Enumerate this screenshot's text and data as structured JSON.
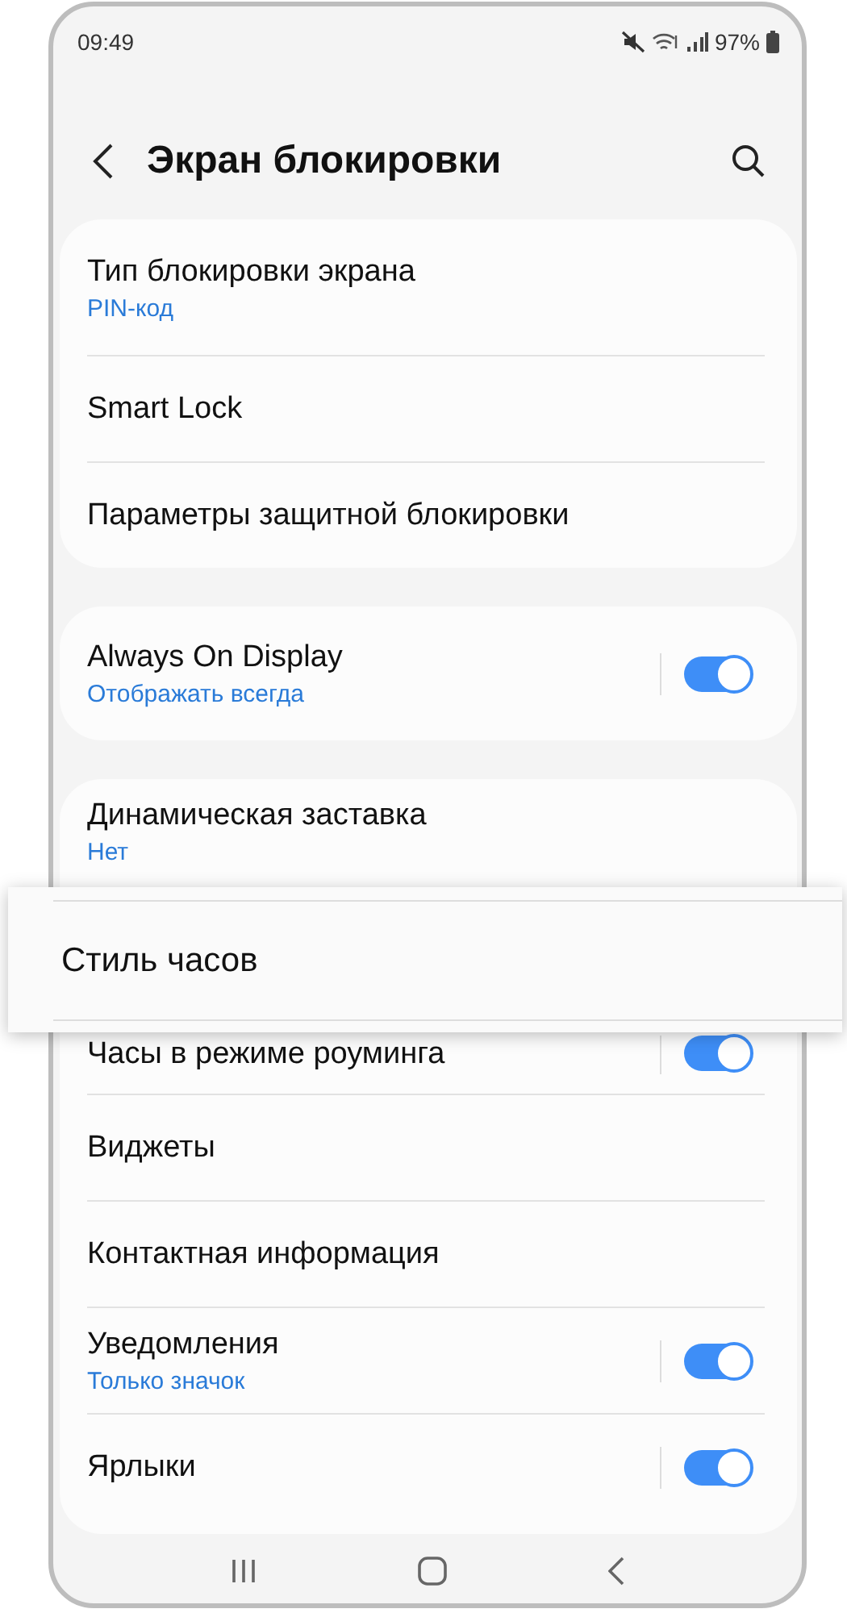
{
  "status_bar": {
    "time": "09:49",
    "battery": "97%"
  },
  "header": {
    "title": "Экран блокировки"
  },
  "groups": [
    {
      "items": [
        {
          "kind": "text",
          "title": "Тип блокировки экрана",
          "subtitle": "PIN-код"
        },
        {
          "kind": "text",
          "title": "Smart Lock"
        },
        {
          "kind": "text",
          "title": "Параметры защитной блокировки"
        }
      ]
    },
    {
      "items": [
        {
          "kind": "toggle",
          "title": "Always On Display",
          "subtitle": "Отображать всегда",
          "on": true
        }
      ]
    },
    {
      "items": [
        {
          "kind": "text",
          "title": "Динамическая заставка",
          "subtitle": "Нет"
        },
        {
          "kind": "highlight",
          "title": "Стиль часов"
        },
        {
          "kind": "partial-toggle",
          "title": "Часы в режиме роуминга",
          "on": true
        },
        {
          "kind": "text",
          "title": "Виджеты"
        },
        {
          "kind": "text",
          "title": "Контактная информация"
        },
        {
          "kind": "toggle",
          "title": "Уведомления",
          "subtitle": "Только значок",
          "on": true
        },
        {
          "kind": "toggle",
          "title": "Ярлыки",
          "on": true
        }
      ]
    }
  ]
}
